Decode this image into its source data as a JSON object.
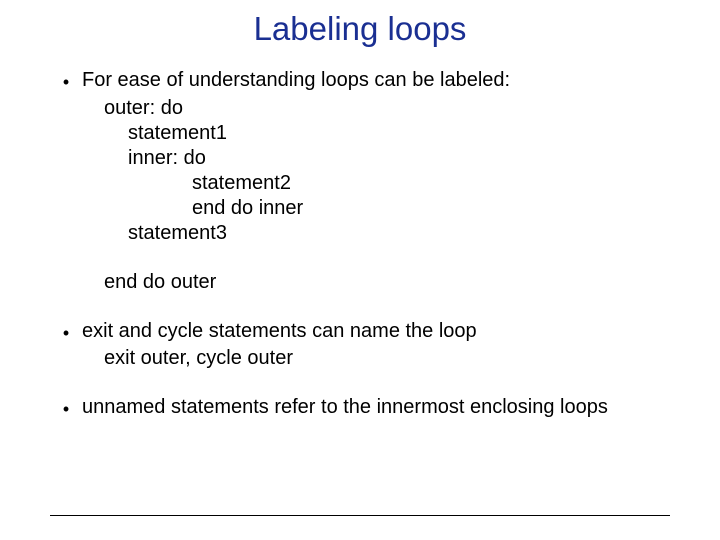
{
  "title": "Labeling loops",
  "bullets": {
    "b1": "For ease of understanding loops can be labeled:",
    "b2": "exit and cycle statements can name the loop",
    "b2_sub": "exit outer, cycle outer",
    "b3": "unnamed statements refer to the innermost enclosing loops"
  },
  "code": {
    "l1": "outer: do",
    "l2": "statement1",
    "l3": "inner: do",
    "l4": "statement2",
    "l5": "end do inner",
    "l6": "statement3",
    "l7": "end do outer"
  }
}
